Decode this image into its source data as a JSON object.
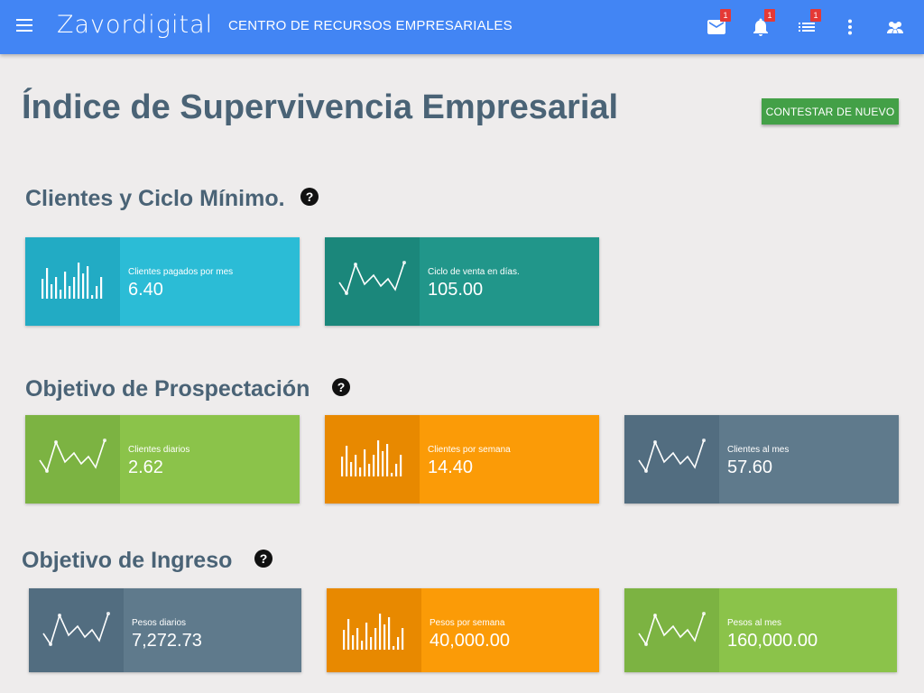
{
  "header": {
    "logo": "Zavordigital",
    "subtitle": "CENTRO DE RECURSOS EMPRESARIALES",
    "mail_badge": "1",
    "notif_badge": "1",
    "tasks_badge": "1"
  },
  "page": {
    "title": "Índice de Supervivencia Empresarial",
    "action_button": "CONTESTAR DE NUEVO"
  },
  "sections": [
    {
      "title": "Clientes y Ciclo Mínimo.",
      "cards": [
        {
          "label": "Clientes pagados por mes",
          "value": "6.40",
          "color": "#2bbcd6",
          "sparkline": "bars"
        },
        {
          "label": "Ciclo de venta en días.",
          "value": "105.00",
          "color": "#21968a",
          "sparkline": "line"
        }
      ]
    },
    {
      "title": "Objetivo de Prospectación",
      "cards": [
        {
          "label": "Clientes diarios",
          "value": "2.62",
          "color": "#8bc34a",
          "sparkline": "line"
        },
        {
          "label": "Clientes por semana",
          "value": "14.40",
          "color": "#fb9b07",
          "sparkline": "bars"
        },
        {
          "label": "Clientes al mes",
          "value": "57.60",
          "color": "#5f7a8c",
          "sparkline": "line"
        }
      ]
    },
    {
      "title": "Objetivo de Ingreso",
      "cards": [
        {
          "label": "Pesos diarios",
          "value": "7,272.73",
          "color": "#5f7a8c",
          "sparkline": "line"
        },
        {
          "label": "Pesos por semana",
          "value": "40,000.00",
          "color": "#fb9b07",
          "sparkline": "bars"
        },
        {
          "label": "Pesos al mes",
          "value": "160,000.00",
          "color": "#8bc34a",
          "sparkline": "line"
        }
      ]
    }
  ]
}
